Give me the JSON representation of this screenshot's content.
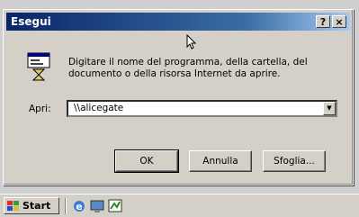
{
  "window": {
    "title": "Esegui",
    "help_label": "?",
    "close_label": "×"
  },
  "icons": [
    "run-icon",
    "help-icon",
    "close-icon",
    "chevron-down-icon",
    "windows-logo-icon",
    "ie-icon",
    "desktop-icon",
    "channels-icon",
    "mouse-cursor-icon"
  ],
  "description": "Digitare il nome del programma, della cartella, del documento o della risorsa Internet da aprire.",
  "open_field": {
    "label": "Apri:",
    "value": "\\\\alicegate"
  },
  "buttons": {
    "ok": "OK",
    "cancel": "Annulla",
    "browse": "Sfoglia..."
  },
  "taskbar": {
    "start_label": "Start"
  }
}
